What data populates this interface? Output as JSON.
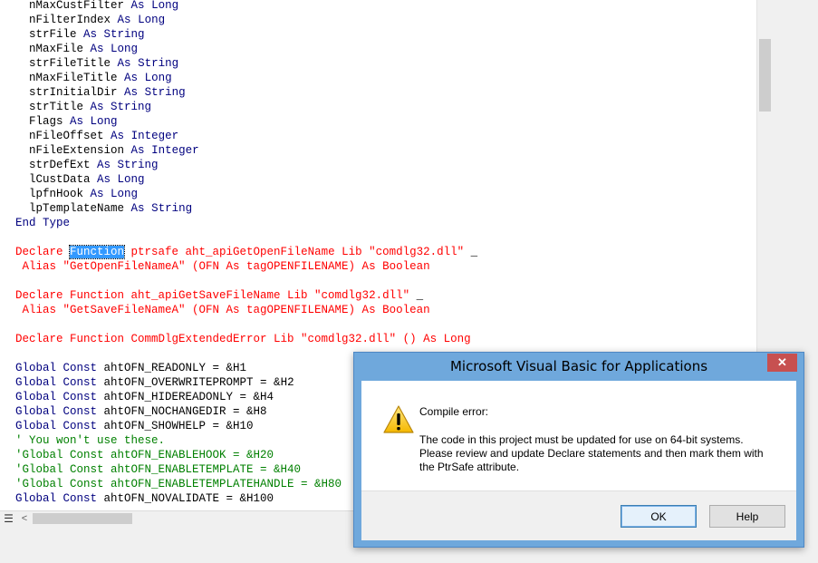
{
  "code": {
    "lines": [
      {
        "segs": [
          {
            "t": "  nMaxCustFilter ",
            "c": "id"
          },
          {
            "t": "As",
            "c": "kw"
          },
          {
            "t": " ",
            "c": "id"
          },
          {
            "t": "Long",
            "c": "kw"
          }
        ]
      },
      {
        "segs": [
          {
            "t": "  nFilterIndex ",
            "c": "id"
          },
          {
            "t": "As",
            "c": "kw"
          },
          {
            "t": " ",
            "c": "id"
          },
          {
            "t": "Long",
            "c": "kw"
          }
        ]
      },
      {
        "segs": [
          {
            "t": "  strFile ",
            "c": "id"
          },
          {
            "t": "As",
            "c": "kw"
          },
          {
            "t": " ",
            "c": "id"
          },
          {
            "t": "String",
            "c": "kw"
          }
        ]
      },
      {
        "segs": [
          {
            "t": "  nMaxFile ",
            "c": "id"
          },
          {
            "t": "As",
            "c": "kw"
          },
          {
            "t": " ",
            "c": "id"
          },
          {
            "t": "Long",
            "c": "kw"
          }
        ]
      },
      {
        "segs": [
          {
            "t": "  strFileTitle ",
            "c": "id"
          },
          {
            "t": "As",
            "c": "kw"
          },
          {
            "t": " ",
            "c": "id"
          },
          {
            "t": "String",
            "c": "kw"
          }
        ]
      },
      {
        "segs": [
          {
            "t": "  nMaxFileTitle ",
            "c": "id"
          },
          {
            "t": "As",
            "c": "kw"
          },
          {
            "t": " ",
            "c": "id"
          },
          {
            "t": "Long",
            "c": "kw"
          }
        ]
      },
      {
        "segs": [
          {
            "t": "  strInitialDir ",
            "c": "id"
          },
          {
            "t": "As",
            "c": "kw"
          },
          {
            "t": " ",
            "c": "id"
          },
          {
            "t": "String",
            "c": "kw"
          }
        ]
      },
      {
        "segs": [
          {
            "t": "  strTitle ",
            "c": "id"
          },
          {
            "t": "As",
            "c": "kw"
          },
          {
            "t": " ",
            "c": "id"
          },
          {
            "t": "String",
            "c": "kw"
          }
        ]
      },
      {
        "segs": [
          {
            "t": "  Flags ",
            "c": "id"
          },
          {
            "t": "As",
            "c": "kw"
          },
          {
            "t": " ",
            "c": "id"
          },
          {
            "t": "Long",
            "c": "kw"
          }
        ]
      },
      {
        "segs": [
          {
            "t": "  nFileOffset ",
            "c": "id"
          },
          {
            "t": "As",
            "c": "kw"
          },
          {
            "t": " ",
            "c": "id"
          },
          {
            "t": "Integer",
            "c": "kw"
          }
        ]
      },
      {
        "segs": [
          {
            "t": "  nFileExtension ",
            "c": "id"
          },
          {
            "t": "As",
            "c": "kw"
          },
          {
            "t": " ",
            "c": "id"
          },
          {
            "t": "Integer",
            "c": "kw"
          }
        ]
      },
      {
        "segs": [
          {
            "t": "  strDefExt ",
            "c": "id"
          },
          {
            "t": "As",
            "c": "kw"
          },
          {
            "t": " ",
            "c": "id"
          },
          {
            "t": "String",
            "c": "kw"
          }
        ]
      },
      {
        "segs": [
          {
            "t": "  lCustData ",
            "c": "id"
          },
          {
            "t": "As",
            "c": "kw"
          },
          {
            "t": " ",
            "c": "id"
          },
          {
            "t": "Long",
            "c": "kw"
          }
        ]
      },
      {
        "segs": [
          {
            "t": "  lpfnHook ",
            "c": "id"
          },
          {
            "t": "As",
            "c": "kw"
          },
          {
            "t": " ",
            "c": "id"
          },
          {
            "t": "Long",
            "c": "kw"
          }
        ]
      },
      {
        "segs": [
          {
            "t": "  lpTemplateName ",
            "c": "id"
          },
          {
            "t": "As",
            "c": "kw"
          },
          {
            "t": " ",
            "c": "id"
          },
          {
            "t": "String",
            "c": "kw"
          }
        ]
      },
      {
        "segs": [
          {
            "t": "End Type",
            "c": "kw"
          }
        ]
      },
      {
        "segs": []
      },
      {
        "segs": [
          {
            "t": "Declare ",
            "c": "err"
          },
          {
            "t": "Function",
            "c": "sel"
          },
          {
            "t": " ptrsafe aht_apiGetOpenFileName Lib \"comdlg32.dll\" ",
            "c": "err"
          },
          {
            "t": "_",
            "c": "id"
          }
        ]
      },
      {
        "segs": [
          {
            "t": " Alias \"GetOpenFileNameA\" (OFN As tagOPENFILENAME) As Boolean",
            "c": "err"
          }
        ]
      },
      {
        "segs": []
      },
      {
        "segs": [
          {
            "t": "Declare Function aht_apiGetSaveFileName Lib \"comdlg32.dll\" ",
            "c": "err"
          },
          {
            "t": "_",
            "c": "id"
          }
        ]
      },
      {
        "segs": [
          {
            "t": " Alias \"GetSaveFileNameA\" (OFN As tagOPENFILENAME) As Boolean",
            "c": "err"
          }
        ]
      },
      {
        "segs": []
      },
      {
        "segs": [
          {
            "t": "Declare Function CommDlgExtendedError Lib \"comdlg32.dll\" () As Long",
            "c": "err"
          }
        ]
      },
      {
        "segs": []
      },
      {
        "segs": [
          {
            "t": "Global Const ",
            "c": "kw"
          },
          {
            "t": "ahtOFN_READONLY = &H1",
            "c": "id"
          }
        ]
      },
      {
        "segs": [
          {
            "t": "Global Const ",
            "c": "kw"
          },
          {
            "t": "ahtOFN_OVERWRITEPROMPT = &H2",
            "c": "id"
          }
        ]
      },
      {
        "segs": [
          {
            "t": "Global Const ",
            "c": "kw"
          },
          {
            "t": "ahtOFN_HIDEREADONLY = &H4",
            "c": "id"
          }
        ]
      },
      {
        "segs": [
          {
            "t": "Global Const ",
            "c": "kw"
          },
          {
            "t": "ahtOFN_NOCHANGEDIR = &H8",
            "c": "id"
          }
        ]
      },
      {
        "segs": [
          {
            "t": "Global Const ",
            "c": "kw"
          },
          {
            "t": "ahtOFN_SHOWHELP = &H10",
            "c": "id"
          }
        ]
      },
      {
        "segs": [
          {
            "t": "' You won't use these.",
            "c": "cm"
          }
        ]
      },
      {
        "segs": [
          {
            "t": "'Global Const ahtOFN_ENABLEHOOK = &H20",
            "c": "cm"
          }
        ]
      },
      {
        "segs": [
          {
            "t": "'Global Const ahtOFN_ENABLETEMPLATE = &H40",
            "c": "cm"
          }
        ]
      },
      {
        "segs": [
          {
            "t": "'Global Const ahtOFN_ENABLETEMPLATEHANDLE = &H80",
            "c": "cm"
          }
        ]
      },
      {
        "segs": [
          {
            "t": "Global Const ",
            "c": "kw"
          },
          {
            "t": "ahtOFN_NOVALIDATE = &H100",
            "c": "id"
          }
        ]
      }
    ]
  },
  "dialog": {
    "title": "Microsoft Visual Basic for Applications",
    "close_glyph": "✕",
    "icon": "warning-icon",
    "error_title": "Compile error:",
    "message": "The code in this project must be updated for use on 64-bit systems.\nPlease review and update Declare statements and then mark them with\nthe PtrSafe attribute.",
    "ok_label": "OK",
    "help_label": "Help"
  },
  "bottombar": {
    "view_icon_glyph": "☰",
    "scroll_left_glyph": "<"
  },
  "colors": {
    "keyword": "#00007f",
    "error": "#ff0000",
    "comment": "#008000",
    "selection": "#3399ff",
    "dialog_frame": "#6fa8dc",
    "close_button": "#c75050"
  }
}
